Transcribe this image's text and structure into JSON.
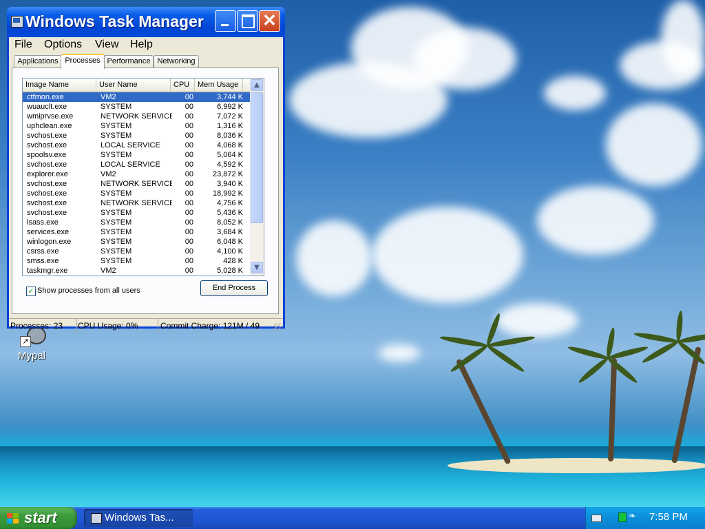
{
  "window": {
    "title": "Windows Task Manager",
    "close_glyph": "✕"
  },
  "menu": [
    "File",
    "Options",
    "View",
    "Help"
  ],
  "tabs": [
    "Applications",
    "Processes",
    "Performance",
    "Networking"
  ],
  "active_tab": "Processes",
  "columns": [
    "Image Name",
    "User Name",
    "CPU",
    "Mem Usage"
  ],
  "processes": [
    {
      "image": "ctfmon.exe",
      "user": "VM2",
      "cpu": "00",
      "mem": "3,744 K"
    },
    {
      "image": "wuauclt.exe",
      "user": "SYSTEM",
      "cpu": "00",
      "mem": "6,992 K"
    },
    {
      "image": "wmiprvse.exe",
      "user": "NETWORK SERVICE",
      "cpu": "00",
      "mem": "7,072 K"
    },
    {
      "image": "uphclean.exe",
      "user": "SYSTEM",
      "cpu": "00",
      "mem": "1,316 K"
    },
    {
      "image": "svchost.exe",
      "user": "SYSTEM",
      "cpu": "00",
      "mem": "8,036 K"
    },
    {
      "image": "svchost.exe",
      "user": "LOCAL SERVICE",
      "cpu": "00",
      "mem": "4,068 K"
    },
    {
      "image": "spoolsv.exe",
      "user": "SYSTEM",
      "cpu": "00",
      "mem": "5,064 K"
    },
    {
      "image": "svchost.exe",
      "user": "LOCAL SERVICE",
      "cpu": "00",
      "mem": "4,592 K"
    },
    {
      "image": "explorer.exe",
      "user": "VM2",
      "cpu": "00",
      "mem": "23,872 K"
    },
    {
      "image": "svchost.exe",
      "user": "NETWORK SERVICE",
      "cpu": "00",
      "mem": "3,940 K"
    },
    {
      "image": "svchost.exe",
      "user": "SYSTEM",
      "cpu": "00",
      "mem": "18,992 K"
    },
    {
      "image": "svchost.exe",
      "user": "NETWORK SERVICE",
      "cpu": "00",
      "mem": "4,756 K"
    },
    {
      "image": "svchost.exe",
      "user": "SYSTEM",
      "cpu": "00",
      "mem": "5,436 K"
    },
    {
      "image": "lsass.exe",
      "user": "SYSTEM",
      "cpu": "00",
      "mem": "8,052 K"
    },
    {
      "image": "services.exe",
      "user": "SYSTEM",
      "cpu": "00",
      "mem": "3,684 K"
    },
    {
      "image": "winlogon.exe",
      "user": "SYSTEM",
      "cpu": "00",
      "mem": "6,048 K"
    },
    {
      "image": "csrss.exe",
      "user": "SYSTEM",
      "cpu": "00",
      "mem": "4,100 K"
    },
    {
      "image": "smss.exe",
      "user": "SYSTEM",
      "cpu": "00",
      "mem": "428 K"
    },
    {
      "image": "taskmgr.exe",
      "user": "VM2",
      "cpu": "00",
      "mem": "5,028 K"
    }
  ],
  "selected_row": 0,
  "show_all_users": {
    "label": "Show processes from all users",
    "checked": true
  },
  "end_process_label": "End Process",
  "status": {
    "processes": "Processes: 23",
    "cpu": "CPU Usage: 0%",
    "commit": "Commit Charge: 121M / 49"
  },
  "desktop_icon": {
    "label": "Mypal"
  },
  "taskbar": {
    "start_label": "start",
    "task_button_label": "Windows Tas...",
    "clock": "7:58 PM"
  },
  "icons": {
    "title": "taskmgr-icon",
    "scroll_up": "▲",
    "scroll_down": "▼",
    "checkmark": "✓",
    "shortcut_arrow": "↗",
    "vm_tray": "❧"
  },
  "colors": {
    "titlebar": "#0b5ee8",
    "selection": "#316ac5",
    "start_button": "#3c9b3c",
    "taskbar": "#245edb"
  }
}
